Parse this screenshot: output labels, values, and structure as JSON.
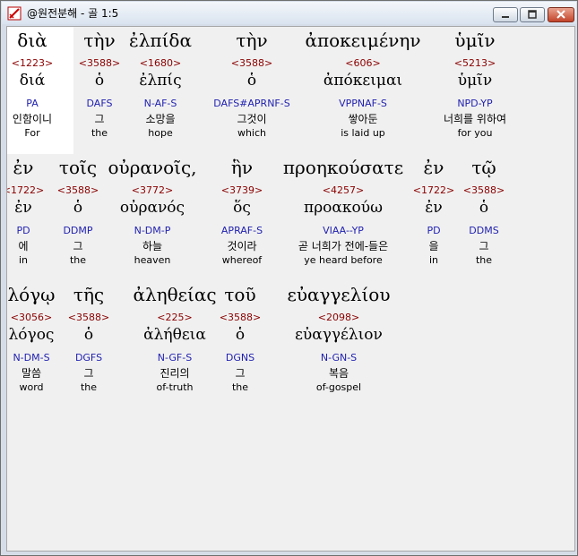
{
  "window": {
    "title": "@원전분해 - 골 1:5"
  },
  "rows": [
    [
      {
        "greek": "διὰ",
        "strong": "<1223>",
        "lemma": "διά",
        "morph": "PA",
        "korean": "인함이니",
        "english": "For"
      },
      {
        "greek": "τὴν",
        "strong": "<3588>",
        "lemma": "ὁ",
        "morph": "DAFS",
        "korean": "그",
        "english": "the"
      },
      {
        "greek": "ἐλπίδα",
        "strong": "<1680>",
        "lemma": "ἐλπίς",
        "morph": "N-AF-S",
        "korean": "소망을",
        "english": "hope"
      },
      {
        "greek": "τὴν",
        "strong": "<3588>",
        "lemma": "ὁ",
        "morph": "DAFS#APRNF-S",
        "korean": "그것이",
        "english": "which"
      },
      {
        "greek": "ἀποκειμένην",
        "strong": "<606>",
        "lemma": "ἀπόκειμαι",
        "morph": "VPPNAF-S",
        "korean": "쌓아둔",
        "english": "is laid up"
      },
      {
        "greek": "ὑμῖν",
        "strong": "<5213>",
        "lemma": "ὑμῖν",
        "morph": "NPD-YP",
        "korean": "너희를 위하여",
        "english": "for you"
      }
    ],
    [
      {
        "greek": "ἐν",
        "strong": "<1722>",
        "lemma": "ἐν",
        "morph": "PD",
        "korean": "에",
        "english": "in"
      },
      {
        "greek": "τοῖς",
        "strong": "<3588>",
        "lemma": "ὁ",
        "morph": "DDMP",
        "korean": "그",
        "english": "the"
      },
      {
        "greek": "οὐρανοῖς,",
        "strong": "<3772>",
        "lemma": "οὐρανός",
        "morph": "N-DM-P",
        "korean": "하늘",
        "english": "heaven"
      },
      {
        "greek": "ἣν",
        "strong": "<3739>",
        "lemma": "ὅς",
        "morph": "APRAF-S",
        "korean": "것이라",
        "english": "whereof"
      },
      {
        "greek": "προηκούσατε",
        "strong": "<4257>",
        "lemma": "προακούω",
        "morph": "VIAA--YP",
        "korean": "곧 너희가 전에-들은",
        "english": "ye heard before"
      },
      {
        "greek": "ἐν",
        "strong": "<1722>",
        "lemma": "ἐν",
        "morph": "PD",
        "korean": "을",
        "english": "in"
      },
      {
        "greek": "τῷ",
        "strong": "<3588>",
        "lemma": "ὁ",
        "morph": "DDMS",
        "korean": "그",
        "english": "the"
      }
    ],
    [
      {
        "greek": "λόγῳ",
        "strong": "<3056>",
        "lemma": "λόγος",
        "morph": "N-DM-S",
        "korean": "말씀",
        "english": "word"
      },
      {
        "greek": "τῆς",
        "strong": "<3588>",
        "lemma": "ὁ",
        "morph": "DGFS",
        "korean": "그",
        "english": "the"
      },
      {
        "greek": "ἀληθείας",
        "strong": "<225>",
        "lemma": "ἀλήθεια",
        "morph": "N-GF-S",
        "korean": "진리의",
        "english": "of-truth"
      },
      {
        "greek": "τοῦ",
        "strong": "<3588>",
        "lemma": "ὁ",
        "morph": "DGNS",
        "korean": "그",
        "english": "the"
      },
      {
        "greek": "εὐαγγελίου",
        "strong": "<2098>",
        "lemma": "εὐαγγέλιον",
        "morph": "N-GN-S",
        "korean": "복음",
        "english": "of-gospel"
      }
    ]
  ],
  "colors": {
    "strong": "#8b0000",
    "morph": "#1f1fb0",
    "highlight": "#ffffff",
    "client_bg": "#f0f0f0"
  },
  "icons": {
    "app": "app-icon",
    "minimize": "minimize-icon",
    "maximize": "maximize-icon",
    "close": "close-icon"
  }
}
